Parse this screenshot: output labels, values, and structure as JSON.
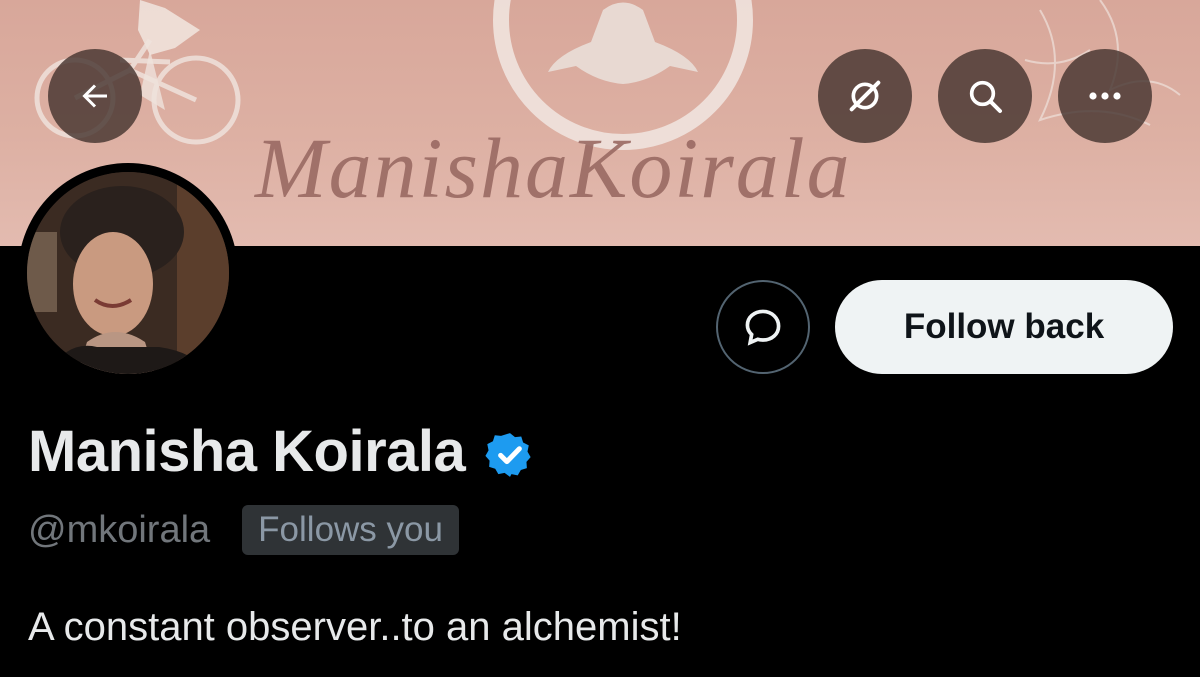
{
  "banner": {
    "title": "ManishaKoirala",
    "background_color": "#d8a79a",
    "title_color": "#9a6a63"
  },
  "header_actions": {
    "back": {
      "icon": "arrow-left-icon"
    },
    "grok": {
      "icon": "grok-icon"
    },
    "search": {
      "icon": "search-icon"
    },
    "more": {
      "icon": "more-icon"
    }
  },
  "profile": {
    "display_name": "Manisha Koirala",
    "verified": true,
    "verified_color": "#1d9bf0",
    "handle": "@mkoirala",
    "follows_you_label": "Follows you",
    "bio": "A constant observer..to an alchemist!"
  },
  "actions": {
    "message_icon": "message-icon",
    "follow_label": "Follow back"
  }
}
